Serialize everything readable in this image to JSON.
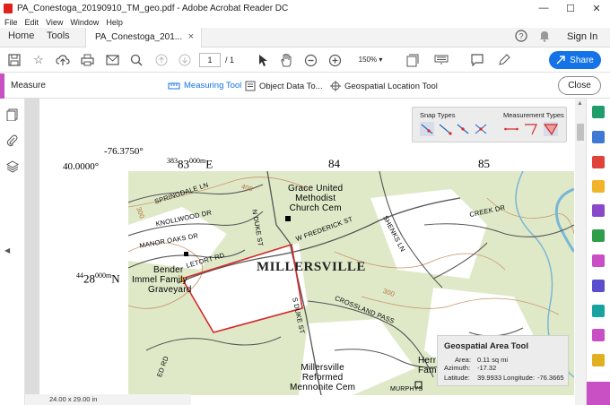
{
  "window": {
    "title": "PA_Conestoga_20190910_TM_geo.pdf - Adobe Acrobat Reader DC",
    "controls": {
      "minimize": "—",
      "maximize": "☐",
      "close": "✕"
    }
  },
  "menu": [
    "File",
    "Edit",
    "View",
    "Window",
    "Help"
  ],
  "tabs": {
    "home": "Home",
    "tools": "Tools",
    "document": "PA_Conestoga_201...",
    "close": "×",
    "signin": "Sign In"
  },
  "toolbar": {
    "page_current": "1",
    "page_total": "/ 1",
    "zoom": "150%",
    "share_label": "Share"
  },
  "measure": {
    "title": "Measure",
    "measuring_tool": "Measuring Tool",
    "object_data_tool": "Object Data To...",
    "geo_location_tool": "Geospatial Location Tool",
    "close_label": "Close"
  },
  "map": {
    "lon_label": "-76.3750°",
    "lat_label": "40.0000°",
    "easting_383": "383",
    "easting_383_sup": "000m",
    "easting_383_suffix": "E",
    "easting_84": "84",
    "easting_85": "85",
    "northing_44": "44",
    "northing_28": "28",
    "northing_28_sup": "000m",
    "northing_28_suffix": "N",
    "town": "MILLERSVILLE",
    "labels": {
      "springdale": "SPRINGDALE LN",
      "knollwood": "KNOLLWOOD DR",
      "manor_oaks": "MANOR OAKS DR",
      "letort": "LETORT RD",
      "n_duke": "N DUKE ST",
      "s_duke": "S DUKE ST",
      "w_frederick": "W FREDERICK ST",
      "shenks": "SHENKS LN",
      "creek": "CREEK DR",
      "crossland": "CROSSLAND PASS",
      "grace_1": "Grace United",
      "grace_2": "Methodist",
      "grace_3": "Church Cem",
      "bender_1": "Bender",
      "bender_2": "Immel Family",
      "bender_3": "Graveyard",
      "mreformed_1": "Millersville",
      "mreformed_2": "Reformed",
      "mreformed_3": "Mennonite Cem",
      "herr_1": "Herr",
      "herr_2": "Fami",
      "contour_300a": "300",
      "contour_300b": "300",
      "contour_400": "400",
      "murphy": "MURPHYS",
      "ed_rd": "ED RD"
    }
  },
  "snap_panel": {
    "snap_types": "Snap Types",
    "measurement_types": "Measurement Types"
  },
  "geo_panel": {
    "title": "Geospatial Area Tool",
    "area_label": "Area:",
    "area_value": "0.11 sq mi",
    "azimuth_label": "Azimuth:",
    "azimuth_value": "-17.32",
    "latitude_label": "Latitude:",
    "latitude_value": "39.9933",
    "longitude_label": "Longitude:",
    "longitude_value": "-76.3665"
  },
  "status": {
    "page_size": "24.00 x 29.00 in"
  },
  "colors": {
    "accent": "#1473e6",
    "measure_accent": "#c94fc4",
    "polygon": "#d42a2a",
    "map_bg": "#dfe9c8"
  }
}
